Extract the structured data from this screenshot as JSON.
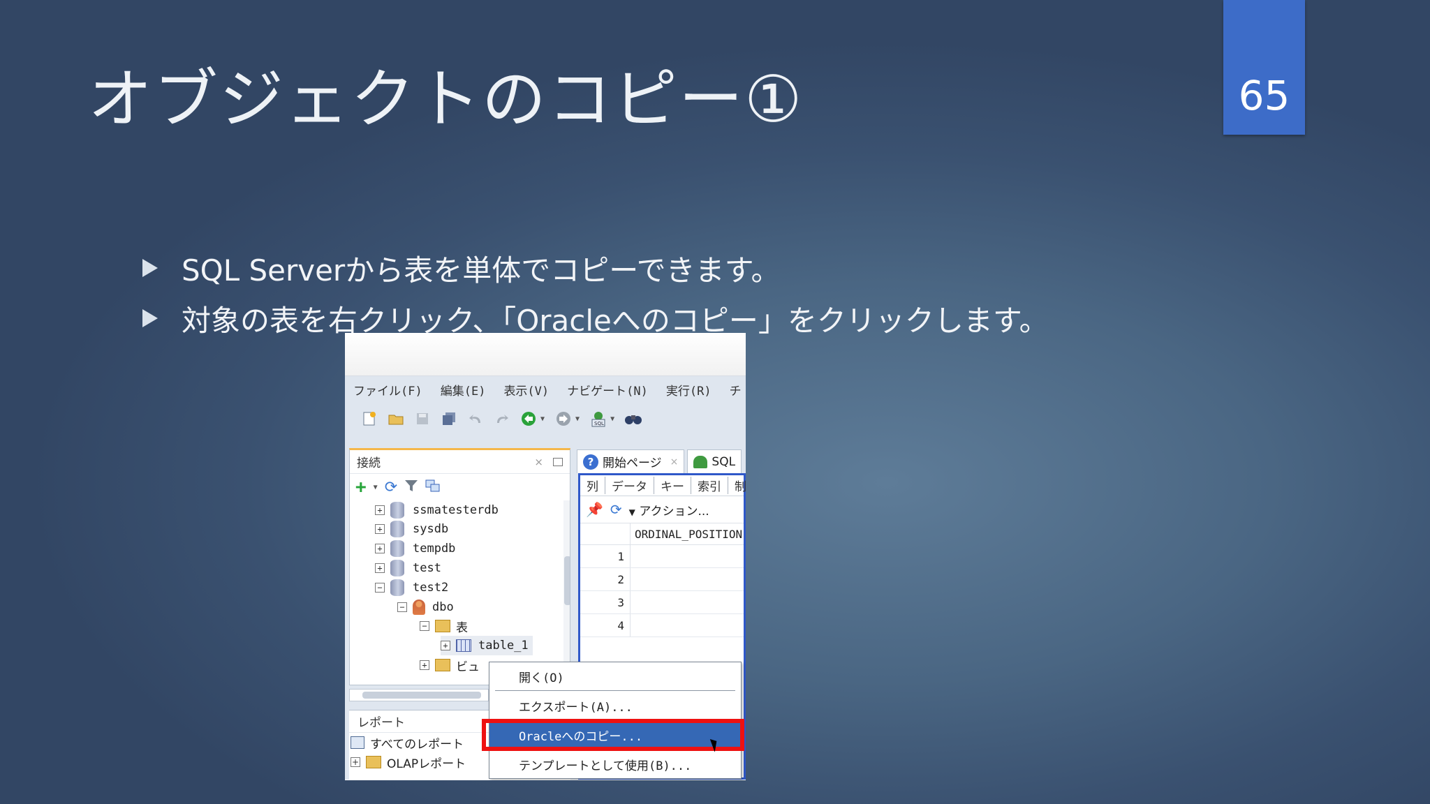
{
  "slide": {
    "title": "オブジェクトのコピー①",
    "page_number": "65",
    "bullets": [
      "SQL Serverから表を単体でコピーできます。",
      "対象の表を右クリック、「Oracleへのコピー」をクリックします。"
    ]
  },
  "app": {
    "menu": [
      "ファイル(F)",
      "編集(E)",
      "表示(V)",
      "ナビゲート(N)",
      "実行(R)",
      "チ"
    ],
    "connections": {
      "title": "接続",
      "close": "×",
      "tree": [
        {
          "label": "ssmatesterdb",
          "icon": "database-icon"
        },
        {
          "label": "sysdb",
          "icon": "database-icon"
        },
        {
          "label": "tempdb",
          "icon": "database-icon"
        },
        {
          "label": "test",
          "icon": "database-icon"
        },
        {
          "label": "test2",
          "icon": "database-icon"
        },
        {
          "label": "dbo",
          "icon": "schema-user-icon"
        },
        {
          "label": "表",
          "icon": "folder-icon"
        },
        {
          "label": "table_1",
          "icon": "table-icon"
        },
        {
          "label": "ビュ",
          "icon": "view-folder-icon"
        }
      ]
    },
    "reports": {
      "title": "レポート",
      "items": [
        "すべてのレポート",
        "OLAPレポート"
      ]
    },
    "tabs": [
      {
        "label": "開始ページ",
        "close": "×"
      },
      {
        "label": "SQL"
      }
    ],
    "subtabs": [
      "列",
      "データ",
      "キー",
      "索引",
      "制"
    ],
    "actions_label": "アクション...",
    "grid": {
      "column": "ORDINAL_POSITION",
      "rows": [
        "1",
        "2",
        "3",
        "4"
      ]
    },
    "context_menu": [
      {
        "label": "開く(O)"
      },
      {
        "label": "エクスポート(A)..."
      },
      {
        "label": "Oracleへのコピー...",
        "selected": true
      },
      {
        "label": "テンプレートとして使用(B)..."
      }
    ],
    "colors": {
      "selection": "#3568b5",
      "highlight": "#ee1111",
      "badge": "#3d6cc8"
    }
  }
}
